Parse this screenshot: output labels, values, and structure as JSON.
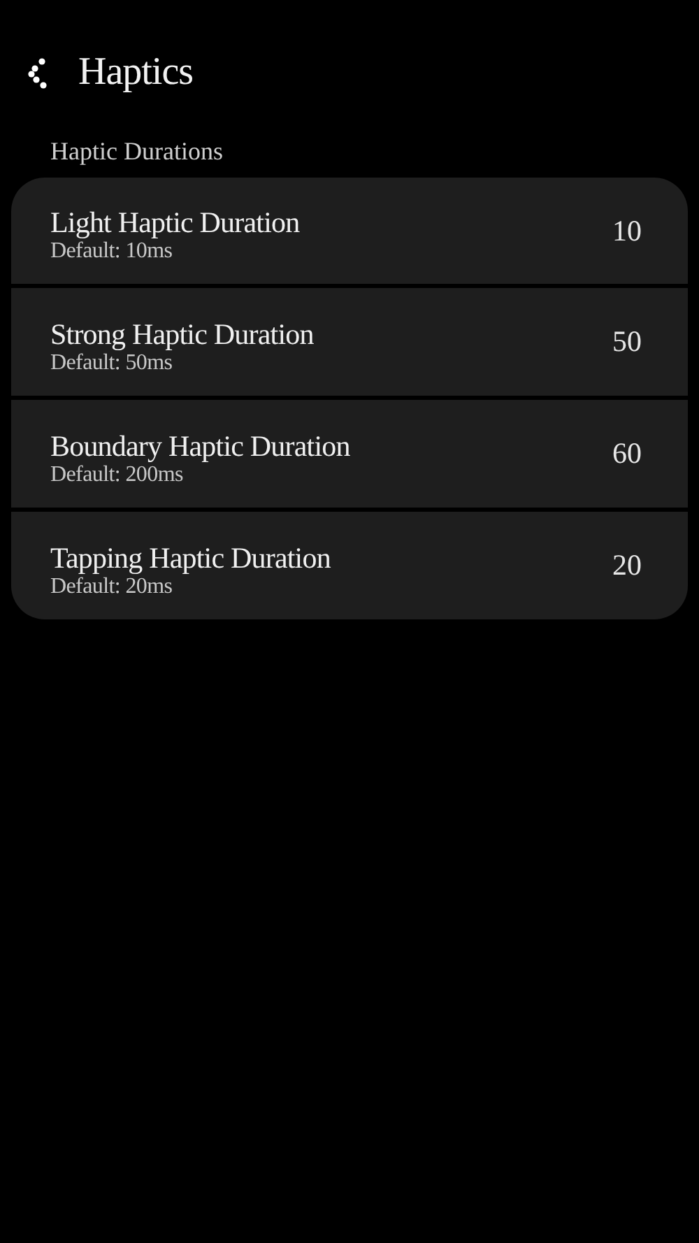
{
  "header": {
    "title": "Haptics"
  },
  "section": {
    "title": "Haptic Durations"
  },
  "settings": [
    {
      "label": "Light Haptic Duration",
      "description": "Default: 10ms",
      "value": "10"
    },
    {
      "label": "Strong Haptic Duration",
      "description": "Default: 50ms",
      "value": "50"
    },
    {
      "label": "Boundary Haptic Duration",
      "description": "Default: 200ms",
      "value": "60"
    },
    {
      "label": "Tapping Haptic Duration",
      "description": "Default: 20ms",
      "value": "20"
    }
  ]
}
